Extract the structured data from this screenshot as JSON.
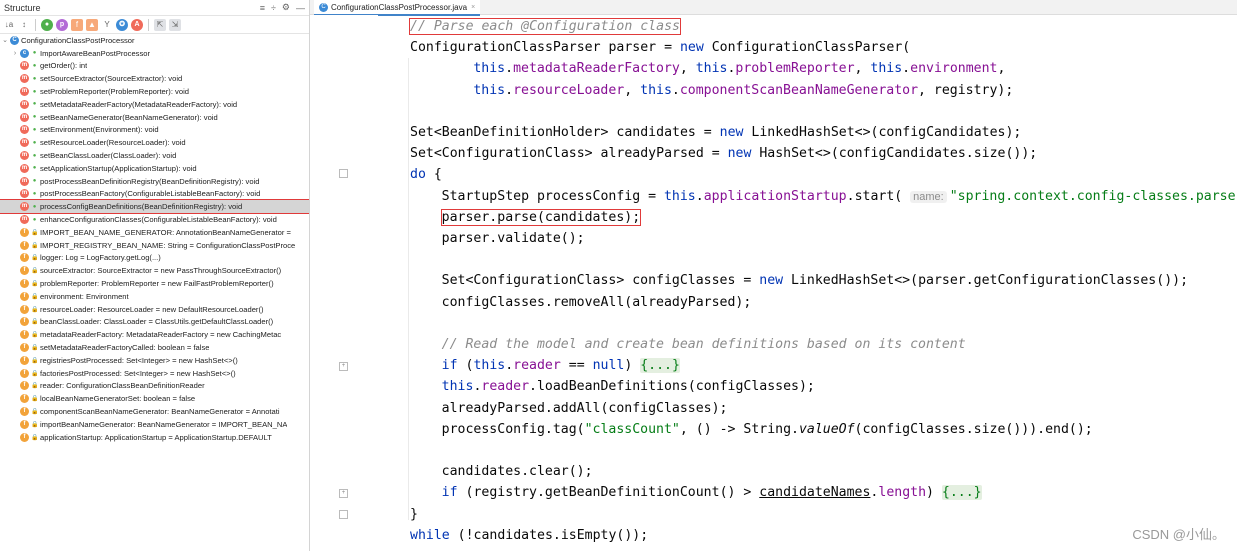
{
  "structure": {
    "title": "Structure",
    "controls": [
      "≡",
      "÷",
      "⚙",
      "—"
    ],
    "toolbar": [
      "↓a",
      "↕",
      "●",
      "p",
      "f",
      "▲",
      "Y",
      "✪",
      "A"
    ],
    "root": "ConfigurationClassPostProcessor",
    "items": [
      {
        "kind": "c",
        "lock": false,
        "label": "ImportAwareBeanPostProcessor",
        "arrow": "›"
      },
      {
        "kind": "m",
        "lock": false,
        "label": "getOrder(): int"
      },
      {
        "kind": "m",
        "lock": false,
        "label": "setSourceExtractor(SourceExtractor): void"
      },
      {
        "kind": "m",
        "lock": false,
        "label": "setProblemReporter(ProblemReporter): void"
      },
      {
        "kind": "m",
        "lock": false,
        "label": "setMetadataReaderFactory(MetadataReaderFactory): void"
      },
      {
        "kind": "m",
        "lock": false,
        "label": "setBeanNameGenerator(BeanNameGenerator): void"
      },
      {
        "kind": "m",
        "lock": false,
        "label": "setEnvironment(Environment): void"
      },
      {
        "kind": "m",
        "lock": false,
        "label": "setResourceLoader(ResourceLoader): void"
      },
      {
        "kind": "m",
        "lock": false,
        "label": "setBeanClassLoader(ClassLoader): void"
      },
      {
        "kind": "m",
        "lock": false,
        "label": "setApplicationStartup(ApplicationStartup): void"
      },
      {
        "kind": "m",
        "lock": false,
        "label": "postProcessBeanDefinitionRegistry(BeanDefinitionRegistry): void"
      },
      {
        "kind": "m",
        "lock": false,
        "label": "postProcessBeanFactory(ConfigurableListableBeanFactory): void"
      },
      {
        "kind": "m",
        "lock": false,
        "label": "processConfigBeanDefinitions(BeanDefinitionRegistry): void",
        "selected": true
      },
      {
        "kind": "m",
        "lock": false,
        "label": "enhanceConfigurationClasses(ConfigurableListableBeanFactory): void"
      },
      {
        "kind": "f",
        "lock": true,
        "label": "IMPORT_BEAN_NAME_GENERATOR: AnnotationBeanNameGenerator ="
      },
      {
        "kind": "f",
        "lock": true,
        "label": "IMPORT_REGISTRY_BEAN_NAME: String = ConfigurationClassPostProce"
      },
      {
        "kind": "f",
        "lock": true,
        "label": "logger: Log = LogFactory.getLog(...)"
      },
      {
        "kind": "f",
        "lock": true,
        "label": "sourceExtractor: SourceExtractor = new PassThroughSourceExtractor()"
      },
      {
        "kind": "f",
        "lock": true,
        "label": "problemReporter: ProblemReporter = new FailFastProblemReporter()"
      },
      {
        "kind": "f",
        "lock": true,
        "label": "environment: Environment"
      },
      {
        "kind": "f",
        "lock": true,
        "label": "resourceLoader: ResourceLoader = new DefaultResourceLoader()"
      },
      {
        "kind": "f",
        "lock": true,
        "label": "beanClassLoader: ClassLoader = ClassUtils.getDefaultClassLoader()"
      },
      {
        "kind": "f",
        "lock": true,
        "label": "metadataReaderFactory: MetadataReaderFactory = new CachingMetac"
      },
      {
        "kind": "f",
        "lock": true,
        "label": "setMetadataReaderFactoryCalled: boolean = false"
      },
      {
        "kind": "f",
        "lock": true,
        "label": "registriesPostProcessed: Set<Integer> = new HashSet<>()"
      },
      {
        "kind": "f",
        "lock": true,
        "label": "factoriesPostProcessed: Set<Integer> = new HashSet<>()"
      },
      {
        "kind": "f",
        "lock": true,
        "label": "reader: ConfigurationClassBeanDefinitionReader"
      },
      {
        "kind": "f",
        "lock": true,
        "label": "localBeanNameGeneratorSet: boolean = false"
      },
      {
        "kind": "f",
        "lock": true,
        "label": "componentScanBeanNameGenerator: BeanNameGenerator = Annotati"
      },
      {
        "kind": "f",
        "lock": true,
        "label": "importBeanNameGenerator: BeanNameGenerator = IMPORT_BEAN_NA"
      },
      {
        "kind": "f",
        "lock": true,
        "label": "applicationStartup: ApplicationStartup = ApplicationStartup.DEFAULT"
      }
    ]
  },
  "editor": {
    "tab_label": "ConfigurationClassPostProcessor.java",
    "tab_close": "×",
    "lines": [
      {
        "indent": 0,
        "box": true,
        "tokens": [
          {
            "c": "cm",
            "t": "// Parse each @Configuration class"
          }
        ]
      },
      {
        "indent": 0,
        "tokens": [
          {
            "t": "ConfigurationClassParser parser = "
          },
          {
            "c": "kw",
            "t": "new "
          },
          {
            "t": "ConfigurationClassParser("
          }
        ]
      },
      {
        "indent": 8,
        "tokens": [
          {
            "c": "kw",
            "t": "this"
          },
          {
            "t": "."
          },
          {
            "c": "fd",
            "t": "metadataReaderFactory"
          },
          {
            "t": ", "
          },
          {
            "c": "kw",
            "t": "this"
          },
          {
            "t": "."
          },
          {
            "c": "fd",
            "t": "problemReporter"
          },
          {
            "t": ", "
          },
          {
            "c": "kw",
            "t": "this"
          },
          {
            "t": "."
          },
          {
            "c": "fd",
            "t": "environment"
          },
          {
            "t": ","
          }
        ]
      },
      {
        "indent": 8,
        "tokens": [
          {
            "c": "kw",
            "t": "this"
          },
          {
            "t": "."
          },
          {
            "c": "fd",
            "t": "resourceLoader"
          },
          {
            "t": ", "
          },
          {
            "c": "kw",
            "t": "this"
          },
          {
            "t": "."
          },
          {
            "c": "fd",
            "t": "componentScanBeanNameGenerator"
          },
          {
            "t": ", registry);"
          }
        ]
      },
      {
        "indent": 0,
        "tokens": []
      },
      {
        "indent": 0,
        "tokens": [
          {
            "t": "Set<BeanDefinitionHolder> candidates = "
          },
          {
            "c": "kw",
            "t": "new "
          },
          {
            "t": "LinkedHashSet<>(configCandidates);"
          }
        ]
      },
      {
        "indent": 0,
        "tokens": [
          {
            "t": "Set<ConfigurationClass> alreadyParsed = "
          },
          {
            "c": "kw",
            "t": "new "
          },
          {
            "t": "HashSet<>(configCandidates.size());"
          }
        ]
      },
      {
        "indent": 0,
        "tokens": [
          {
            "c": "kw",
            "t": "do "
          },
          {
            "t": "{"
          }
        ]
      },
      {
        "indent": 4,
        "tokens": [
          {
            "t": "StartupStep processConfig = "
          },
          {
            "c": "kw",
            "t": "this"
          },
          {
            "t": "."
          },
          {
            "c": "fd",
            "t": "applicationStartup"
          },
          {
            "t": ".start( "
          },
          {
            "c": "hint",
            "t": "name:"
          },
          {
            "c": "st",
            "t": "\"spring.context.config-classes.parse\""
          },
          {
            "t": ");"
          }
        ]
      },
      {
        "indent": 4,
        "box": true,
        "tokens": [
          {
            "t": "parser.parse(candidates);"
          }
        ]
      },
      {
        "indent": 4,
        "tokens": [
          {
            "t": "parser.validate();"
          }
        ]
      },
      {
        "indent": 0,
        "tokens": []
      },
      {
        "indent": 4,
        "tokens": [
          {
            "t": "Set<ConfigurationClass> configClasses = "
          },
          {
            "c": "kw",
            "t": "new "
          },
          {
            "t": "LinkedHashSet<>(parser.getConfigurationClasses());"
          }
        ]
      },
      {
        "indent": 4,
        "tokens": [
          {
            "t": "configClasses.removeAll(alreadyParsed);"
          }
        ]
      },
      {
        "indent": 0,
        "tokens": []
      },
      {
        "indent": 4,
        "tokens": [
          {
            "c": "cm",
            "t": "// Read the model and create bean definitions based on its content"
          }
        ]
      },
      {
        "indent": 4,
        "tokens": [
          {
            "c": "kw",
            "t": "if "
          },
          {
            "t": "("
          },
          {
            "c": "kw",
            "t": "this"
          },
          {
            "t": "."
          },
          {
            "c": "fd",
            "t": "reader "
          },
          {
            "t": "== "
          },
          {
            "c": "kw",
            "t": "null"
          },
          {
            "t": ") "
          },
          {
            "c": "fb",
            "t": "{...}"
          }
        ]
      },
      {
        "indent": 4,
        "tokens": [
          {
            "c": "kw",
            "t": "this"
          },
          {
            "t": "."
          },
          {
            "c": "fd",
            "t": "reader"
          },
          {
            "t": ".loadBeanDefinitions(configClasses);"
          }
        ]
      },
      {
        "indent": 4,
        "tokens": [
          {
            "t": "alreadyParsed.addAll(configClasses);"
          }
        ]
      },
      {
        "indent": 4,
        "tokens": [
          {
            "t": "processConfig.tag("
          },
          {
            "c": "st",
            "t": "\"classCount\""
          },
          {
            "t": ", () -> String."
          },
          {
            "c": "it",
            "t": "valueOf"
          },
          {
            "t": "(configClasses.size())).end();"
          }
        ]
      },
      {
        "indent": 0,
        "tokens": []
      },
      {
        "indent": 4,
        "tokens": [
          {
            "t": "candidates.clear();"
          }
        ]
      },
      {
        "indent": 4,
        "tokens": [
          {
            "c": "kw",
            "t": "if "
          },
          {
            "t": "(registry.getBeanDefinitionCount() > "
          },
          {
            "c": "ul",
            "t": "candidateNames"
          },
          {
            "t": "."
          },
          {
            "c": "fd",
            "t": "length"
          },
          {
            "t": ") "
          },
          {
            "c": "fb",
            "t": "{...}"
          }
        ]
      },
      {
        "indent": 0,
        "tokens": [
          {
            "t": "}"
          }
        ]
      },
      {
        "indent": 0,
        "tokens": [
          {
            "c": "kw",
            "t": "while "
          },
          {
            "t": "(!candidates.isEmpty());"
          }
        ]
      }
    ]
  },
  "watermark": "CSDN @小仙。"
}
